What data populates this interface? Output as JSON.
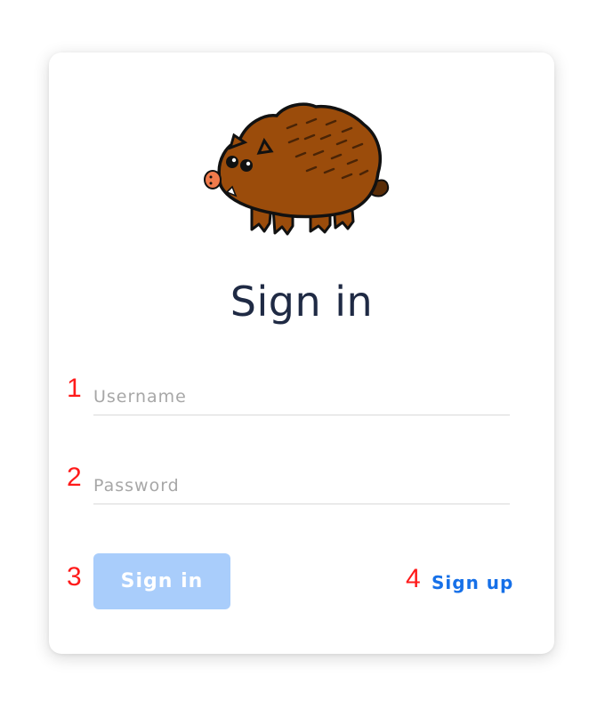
{
  "login": {
    "title": "Sign in",
    "username_placeholder": "Username",
    "password_placeholder": "Password",
    "signin_label": "Sign in",
    "signup_label": "Sign up"
  },
  "annotations": {
    "m1": "1",
    "m2": "2",
    "m3": "3",
    "m4": "4"
  },
  "mascot": {
    "icon": "boar-mascot-icon"
  },
  "colors": {
    "title": "#1f2a44",
    "button_bg": "#a9cdfb",
    "link": "#1670e8",
    "marker": "#ff1a1a",
    "boar_body": "#9b4c0b"
  }
}
